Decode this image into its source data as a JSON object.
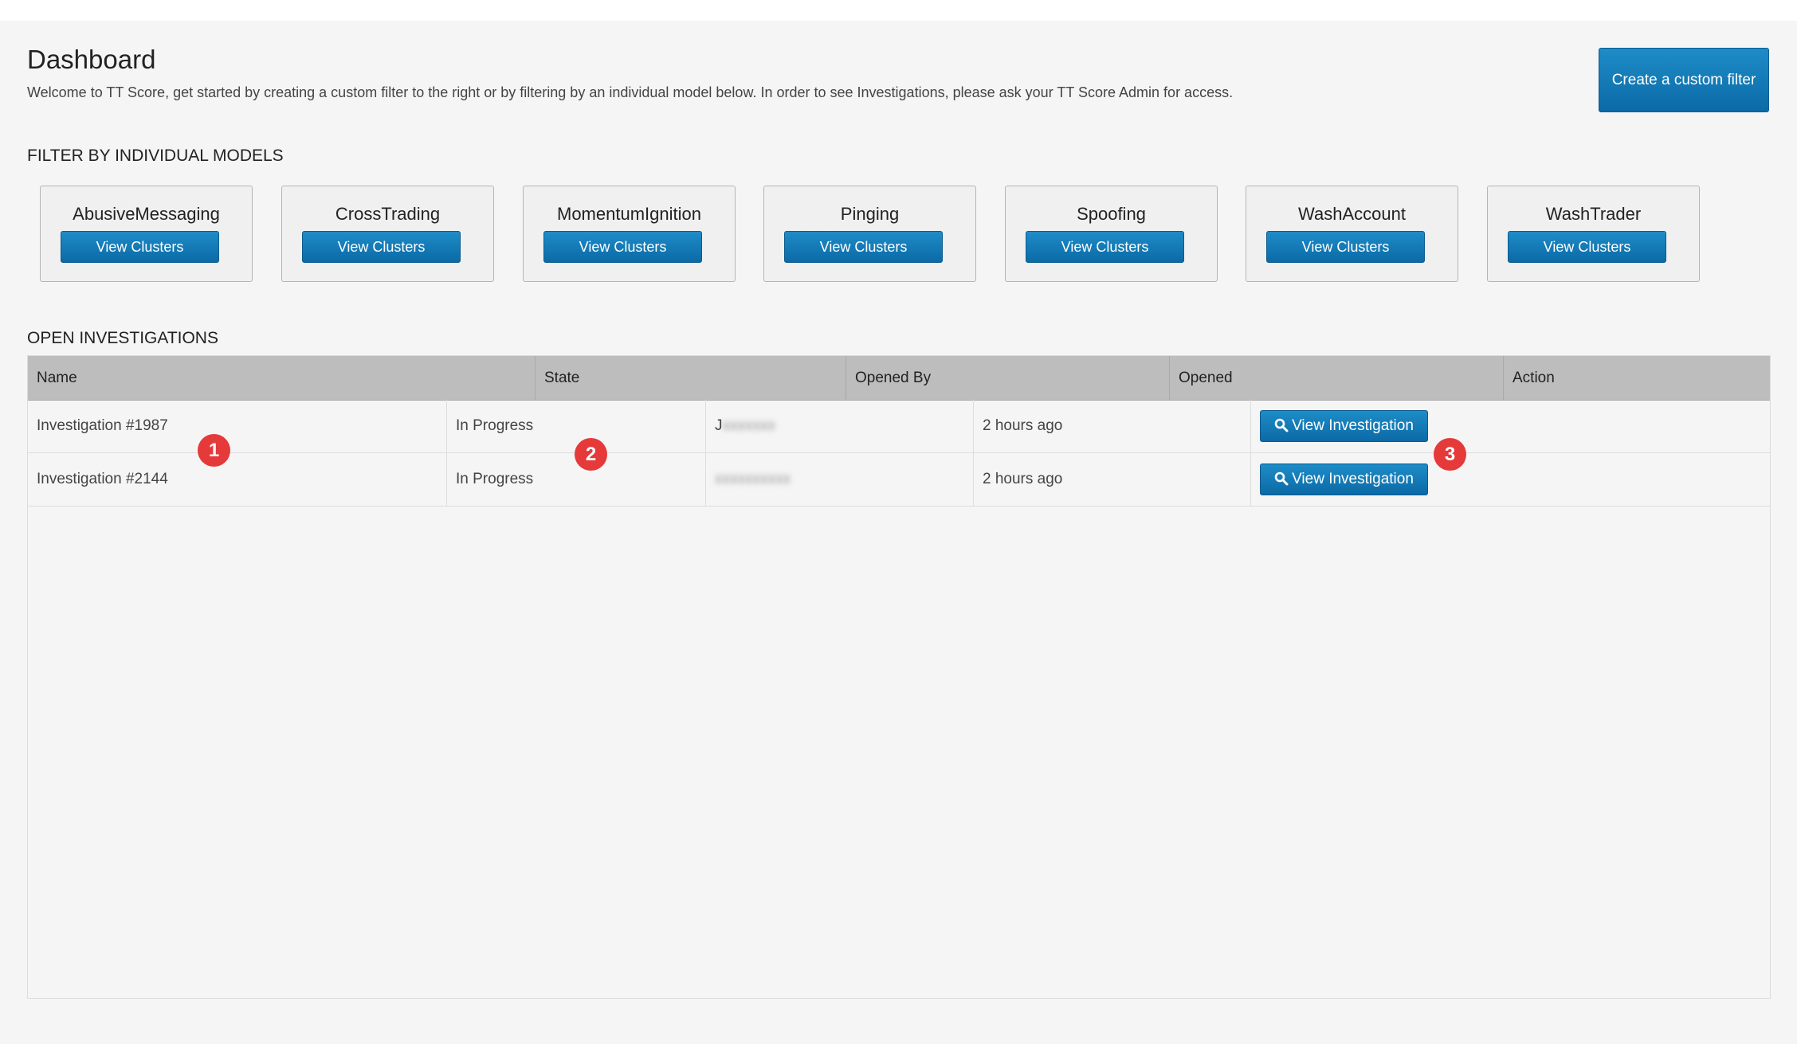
{
  "header": {
    "title": "Dashboard",
    "welcome": "Welcome to TT Score, get started by creating a custom filter to the right or by filtering by an individual model below. In order to see Investigations, please ask your TT Score Admin for access.",
    "create_filter_label": "Create a custom filter"
  },
  "models": {
    "section_title": "FILTER BY INDIVIDUAL MODELS",
    "button_label": "View Clusters",
    "items": [
      {
        "name": "AbusiveMessaging"
      },
      {
        "name": "CrossTrading"
      },
      {
        "name": "MomentumIgnition"
      },
      {
        "name": "Pinging"
      },
      {
        "name": "Spoofing"
      },
      {
        "name": "WashAccount"
      },
      {
        "name": "WashTrader"
      }
    ]
  },
  "investigations": {
    "section_title": "OPEN INVESTIGATIONS",
    "columns": [
      "Name",
      "State",
      "Opened By",
      "Opened",
      "Action"
    ],
    "action_label": "View Investigation",
    "rows": [
      {
        "name": "Investigation #1987",
        "state": "In Progress",
        "opened_by": "J",
        "opened": "2 hours ago"
      },
      {
        "name": "Investigation #2144",
        "state": "In Progress",
        "opened_by": "",
        "opened": "2 hours ago"
      }
    ]
  },
  "markers": [
    "1",
    "2",
    "3"
  ],
  "colors": {
    "accent": "#1279b7",
    "marker": "#e5393a",
    "header_bg": "#bdbdbd",
    "page_bg": "#f5f5f5"
  }
}
